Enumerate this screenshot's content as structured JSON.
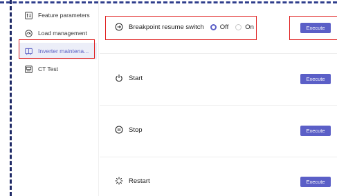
{
  "sidebar": {
    "items": [
      {
        "label": "Feature parameters",
        "icon": "parameters-icon"
      },
      {
        "label": "Load management",
        "icon": "gauge-icon"
      },
      {
        "label": "Inverter maintena...",
        "icon": "inverter-icon"
      },
      {
        "label": "CT Test",
        "icon": "ct-meter-icon"
      }
    ],
    "active_index": 2
  },
  "main": {
    "breakpoint": {
      "label": "Breakpoint resume switch",
      "options": [
        "Off",
        "On"
      ],
      "selected": "Off"
    },
    "rows": [
      {
        "label": "Start",
        "icon": "power-icon"
      },
      {
        "label": "Stop",
        "icon": "pause-icon"
      },
      {
        "label": "Restart",
        "icon": "restart-spinner-icon"
      }
    ],
    "execute_label": "Execute"
  },
  "colors": {
    "accent": "#5b5fc7",
    "highlight": "#e02020",
    "active_bg": "#eceef8"
  }
}
